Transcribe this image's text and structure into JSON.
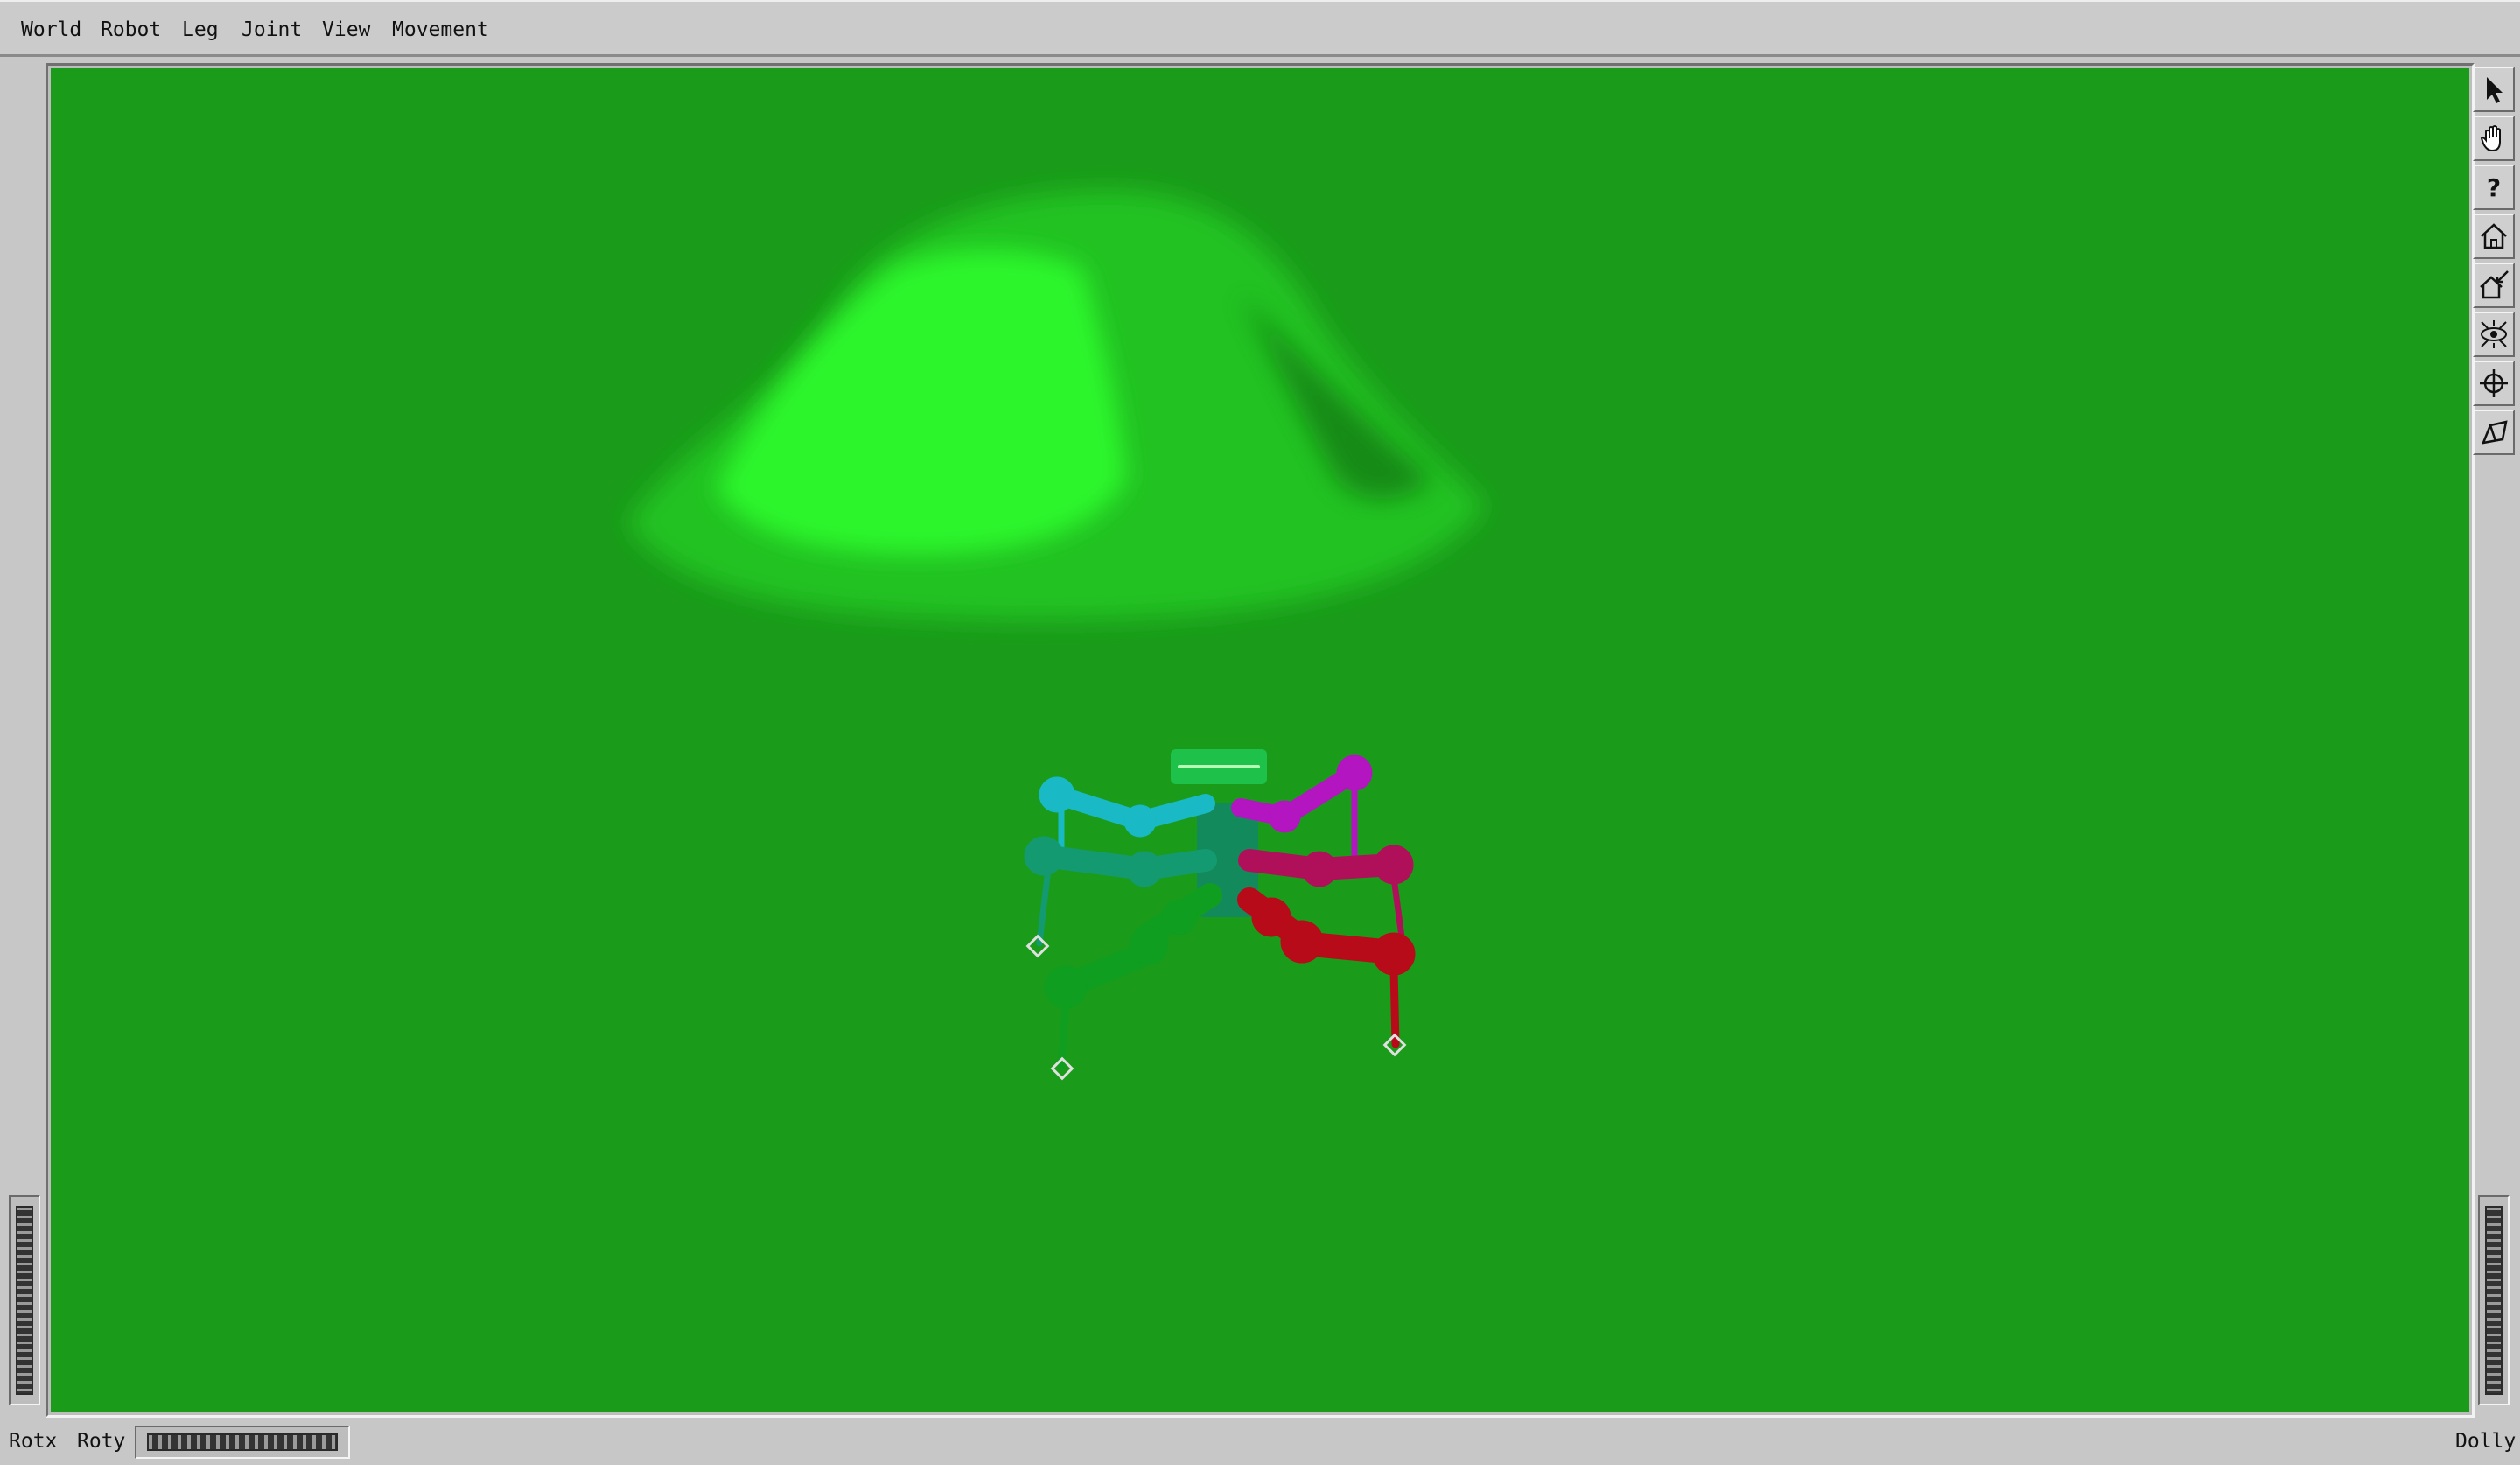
{
  "menubar": {
    "items": [
      "World",
      "Robot",
      "Leg",
      "Joint",
      "View",
      "Movement"
    ]
  },
  "toolbar": {
    "tools": [
      {
        "name": "select-arrow-icon"
      },
      {
        "name": "hand-view-icon"
      },
      {
        "name": "help-icon",
        "glyph": "?"
      },
      {
        "name": "home-icon"
      },
      {
        "name": "set-home-icon"
      },
      {
        "name": "view-all-icon"
      },
      {
        "name": "seek-icon"
      },
      {
        "name": "projection-icon"
      }
    ]
  },
  "wheels": {
    "rotx_label": "Rotx",
    "roty_label": "Roty",
    "dolly_label": "Dolly"
  },
  "scene": {
    "background_color": "#1a9c1a",
    "terrain_color": "#2eff2e",
    "legs": [
      {
        "color": "#19b9c6"
      },
      {
        "color": "#149a70"
      },
      {
        "color": "#0f9e1f"
      },
      {
        "color": "#b315c0"
      },
      {
        "color": "#b0105a"
      },
      {
        "color": "#b80b1a"
      }
    ],
    "body_color": "#138a5c",
    "head_color": "#1ec24a"
  }
}
